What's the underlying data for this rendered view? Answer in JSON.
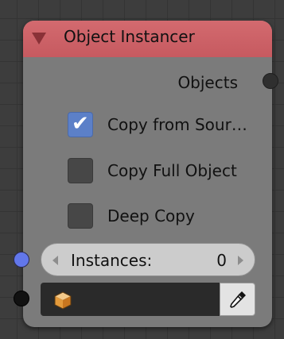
{
  "node": {
    "title": "Object Instancer",
    "output_label": "Objects",
    "options": [
      {
        "label": "Copy from Sour…",
        "checked": true
      },
      {
        "label": "Copy Full Object",
        "checked": false
      },
      {
        "label": "Deep Copy",
        "checked": false
      }
    ],
    "instances": {
      "label": "Instances:",
      "value": "0"
    },
    "object_field": {
      "value": "",
      "icon": "object-cube-icon"
    },
    "picker_icon": "eyedropper-icon"
  },
  "colors": {
    "header": "#c65a60",
    "node_body": "#7b7b7b",
    "checkbox_checked": "#5c80c8",
    "socket_input_blue": "#6277ea"
  }
}
